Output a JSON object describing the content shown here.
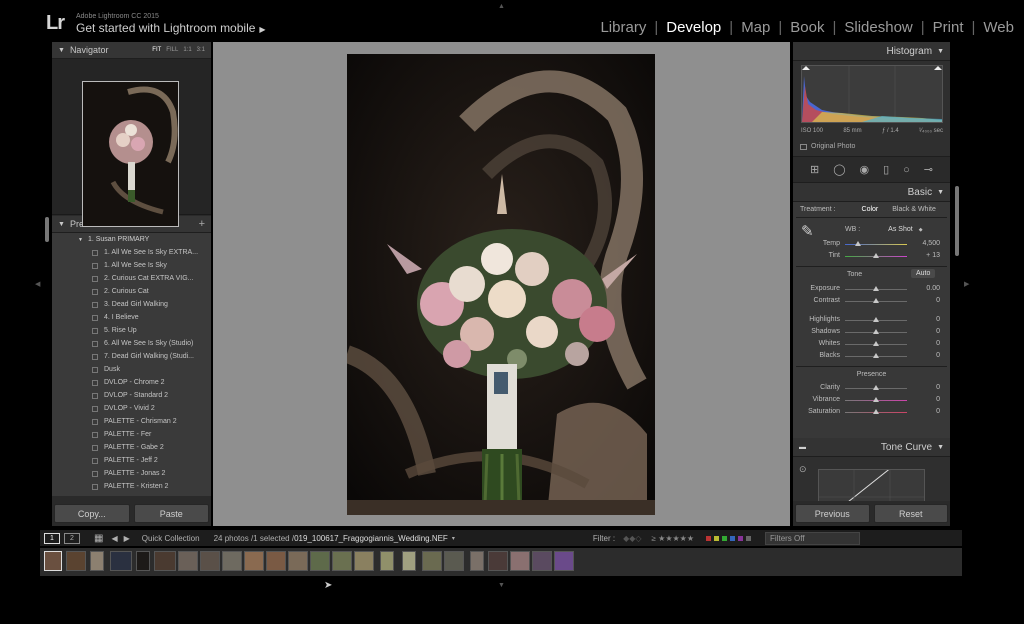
{
  "app": {
    "logo": "Lr",
    "title": "Adobe Lightroom CC 2015",
    "mobile_link": "Get started with Lightroom mobile"
  },
  "modules": [
    {
      "label": "Library",
      "active": false
    },
    {
      "label": "Develop",
      "active": true
    },
    {
      "label": "Map",
      "active": false
    },
    {
      "label": "Book",
      "active": false
    },
    {
      "label": "Slideshow",
      "active": false
    },
    {
      "label": "Print",
      "active": false
    },
    {
      "label": "Web",
      "active": false
    }
  ],
  "navigator": {
    "title": "Navigator",
    "zoom_options": [
      "FIT",
      "FILL",
      "1:1",
      "3:1"
    ],
    "zoom_selected": "FIT"
  },
  "presets": {
    "title": "Presets",
    "folder": "1. Susan PRIMARY",
    "items": [
      "1. All We See Is Sky EXTRA...",
      "1. All We See Is Sky",
      "2. Curious Cat EXTRA VIG...",
      "2. Curious Cat",
      "3. Dead Girl Walking",
      "4. I Believe",
      "5. Rise Up",
      "6. All We See Is Sky (Studio)",
      "7. Dead Girl Walking (Studi...",
      "Dusk",
      "DVLOP - Chrome 2",
      "DVLOP - Standard 2",
      "DVLOP - Vivid 2",
      "PALETTE - Chrisman 2",
      "PALETTE - Fer",
      "PALETTE - Gabe 2",
      "PALETTE - Jeff 2",
      "PALETTE - Jonas 2",
      "PALETTE - Kristen 2"
    ]
  },
  "left_buttons": {
    "copy": "Copy...",
    "paste": "Paste"
  },
  "histogram": {
    "title": "Histogram",
    "iso": "ISO 100",
    "focal": "85 mm",
    "aperture": "ƒ / 1.4",
    "shutter": "¹⁄₄₀₀₀ sec",
    "original_photo": "Original Photo"
  },
  "basic": {
    "title": "Basic",
    "treatment_label": "Treatment :",
    "treatment_color": "Color",
    "treatment_bw": "Black & White",
    "wb_label": "WB :",
    "wb_value": "As Shot",
    "tone_label": "Tone",
    "auto_label": "Auto",
    "presence_label": "Presence",
    "sliders": {
      "temp": {
        "label": "Temp",
        "value": "4,500"
      },
      "tint": {
        "label": "Tint",
        "value": "+ 13"
      },
      "exposure": {
        "label": "Exposure",
        "value": "0.00"
      },
      "contrast": {
        "label": "Contrast",
        "value": "0"
      },
      "highlights": {
        "label": "Highlights",
        "value": "0"
      },
      "shadows": {
        "label": "Shadows",
        "value": "0"
      },
      "whites": {
        "label": "Whites",
        "value": "0"
      },
      "blacks": {
        "label": "Blacks",
        "value": "0"
      },
      "clarity": {
        "label": "Clarity",
        "value": "0"
      },
      "vibrance": {
        "label": "Vibrance",
        "value": "0"
      },
      "saturation": {
        "label": "Saturation",
        "value": "0"
      }
    }
  },
  "tone_curve": {
    "title": "Tone Curve"
  },
  "right_buttons": {
    "previous": "Previous",
    "reset": "Reset"
  },
  "filmstrip": {
    "view1": "1",
    "view2": "2",
    "source": "Quick Collection",
    "count": "24 photos /1 selected /",
    "filename": "019_100617_Fraggogiannis_Wedding.NEF",
    "filter_label": "Filter :",
    "filters_off": "Filters Off"
  },
  "colors": {
    "accent_active": "#ffffff",
    "panel_bg": "#2a2a2a",
    "center_bg": "#8f8f8f"
  }
}
